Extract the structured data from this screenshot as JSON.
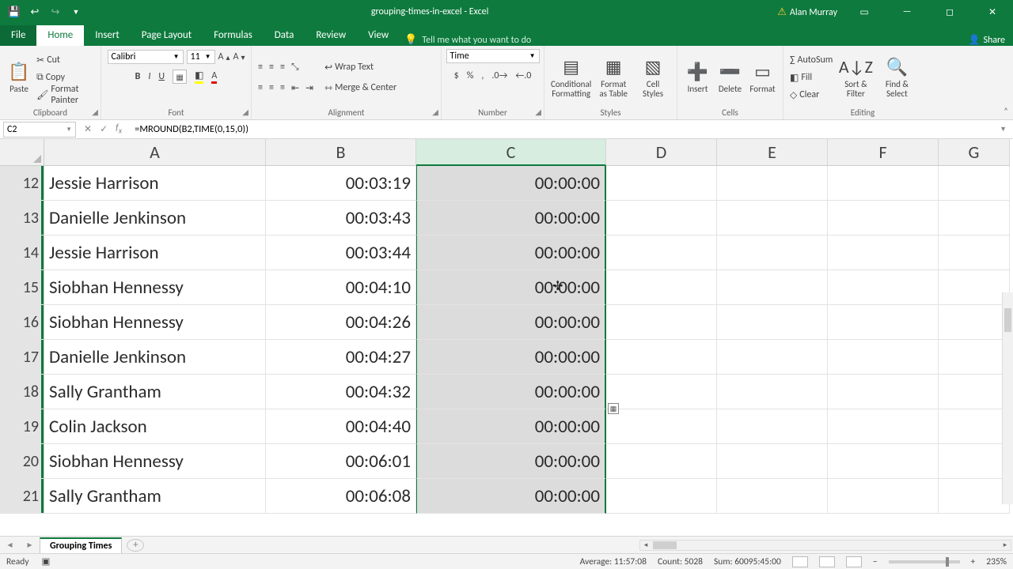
{
  "title": {
    "doc": "grouping-times-in-excel",
    "app": "Excel",
    "user": "Alan Murray"
  },
  "tabs": {
    "file": "File",
    "home": "Home",
    "insert": "Insert",
    "pagelayout": "Page Layout",
    "formulas": "Formulas",
    "data": "Data",
    "review": "Review",
    "view": "View",
    "tellme": "Tell me what you want to do",
    "share": "Share"
  },
  "ribbon": {
    "clipboard": {
      "label": "Clipboard",
      "paste": "Paste",
      "cut": "Cut",
      "copy": "Copy",
      "painter": "Format Painter"
    },
    "font": {
      "label": "Font",
      "name": "Calibri",
      "size": "11"
    },
    "alignment": {
      "label": "Alignment",
      "wrap": "Wrap Text",
      "merge": "Merge & Center"
    },
    "number": {
      "label": "Number",
      "format": "Time"
    },
    "styles": {
      "label": "Styles",
      "cond": "Conditional Formatting",
      "table": "Format as Table",
      "cell": "Cell Styles"
    },
    "cells": {
      "label": "Cells",
      "insert": "Insert",
      "delete": "Delete",
      "format": "Format"
    },
    "editing": {
      "label": "Editing",
      "autosum": "AutoSum",
      "fill": "Fill",
      "clear": "Clear",
      "sort": "Sort & Filter",
      "find": "Find & Select"
    }
  },
  "namebox": "C2",
  "formula": "=MROUND(B2,TIME(0,15,0))",
  "columns": [
    "A",
    "B",
    "C",
    "D",
    "E",
    "F",
    "G"
  ],
  "rows": [
    {
      "num": "12",
      "a": "Jessie Harrison",
      "b": "00:03:19",
      "c": "00:00:00"
    },
    {
      "num": "13",
      "a": "Danielle Jenkinson",
      "b": "00:03:43",
      "c": "00:00:00"
    },
    {
      "num": "14",
      "a": "Jessie Harrison",
      "b": "00:03:44",
      "c": "00:00:00"
    },
    {
      "num": "15",
      "a": "Siobhan Hennessy",
      "b": "00:04:10",
      "c": "00:00:00"
    },
    {
      "num": "16",
      "a": "Siobhan Hennessy",
      "b": "00:04:26",
      "c": "00:00:00"
    },
    {
      "num": "17",
      "a": "Danielle Jenkinson",
      "b": "00:04:27",
      "c": "00:00:00"
    },
    {
      "num": "18",
      "a": "Sally Grantham",
      "b": "00:04:32",
      "c": "00:00:00"
    },
    {
      "num": "19",
      "a": "Colin Jackson",
      "b": "00:04:40",
      "c": "00:00:00"
    },
    {
      "num": "20",
      "a": "Siobhan Hennessy",
      "b": "00:06:01",
      "c": "00:00:00"
    },
    {
      "num": "21",
      "a": "Sally Grantham",
      "b": "00:06:08",
      "c": "00:00:00"
    }
  ],
  "sheet": {
    "name": "Grouping Times"
  },
  "status": {
    "ready": "Ready",
    "avg": "Average: 11:57:08",
    "count": "Count: 5028",
    "sum": "Sum: 60095:45:00",
    "zoom": "235%"
  }
}
